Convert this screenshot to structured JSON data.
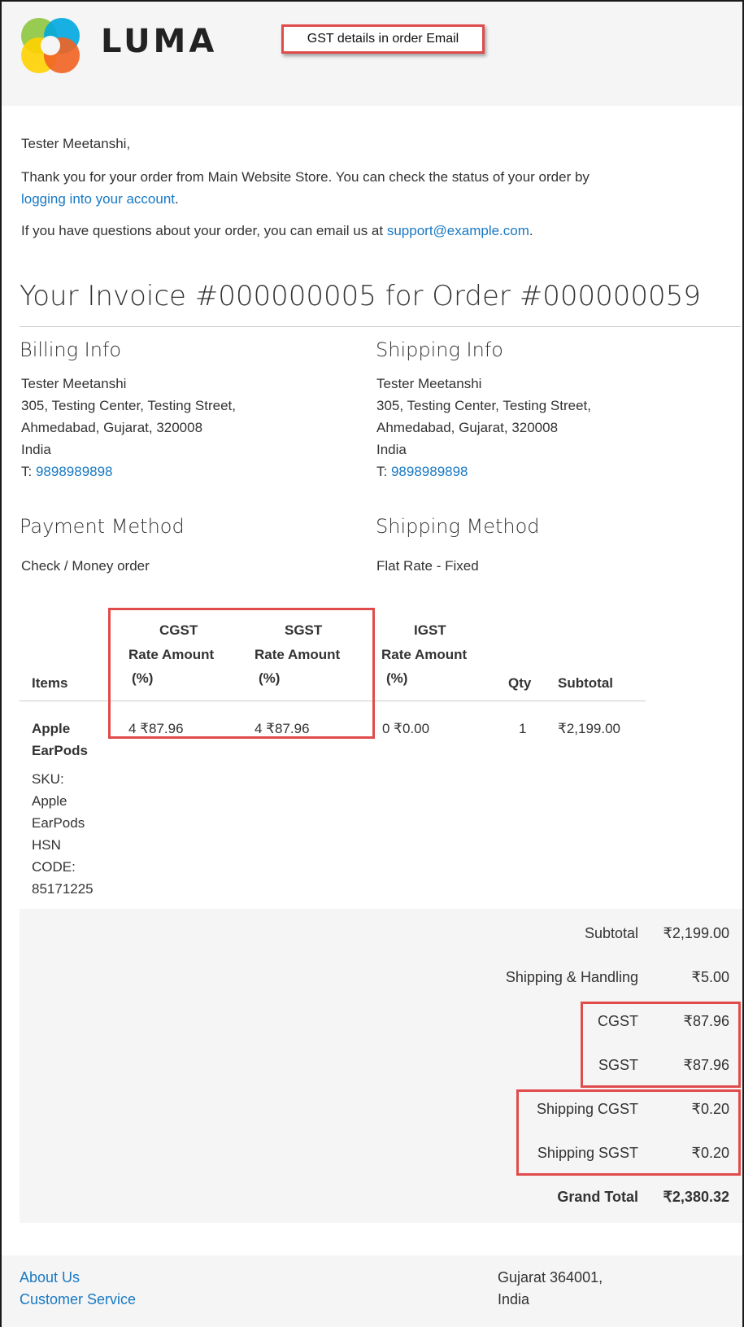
{
  "brand": {
    "logo_text": "LUMA",
    "colors": {
      "blue": "#1979c3",
      "red": "#e04b4b",
      "orange": "#f26322",
      "yellow": "#ffd200",
      "green": "#8dc63f",
      "teal": "#00a9e0"
    }
  },
  "annotation": {
    "label": "GST details in order Email"
  },
  "greeting": "Tester Meetanshi,",
  "intro": {
    "line1": "Thank you for your order from Main Website Store. You can check the status of your order by",
    "link": "logging into your account",
    "link_suffix": "."
  },
  "questions": {
    "text": "If you have questions about your order, you can email us at",
    "email": "support@example.com",
    "suffix": "."
  },
  "invoice_title": "Your Invoice #000000005 for Order #000000059",
  "billing": {
    "heading": "Billing Info",
    "name": "Tester Meetanshi",
    "street": "305, Testing Center, Testing Street,",
    "city": "Ahmedabad, Gujarat, 320008",
    "country": "India",
    "phone_label": "T:",
    "phone": "9898989898"
  },
  "shipping": {
    "heading": "Shipping Info",
    "name": "Tester Meetanshi",
    "street": "305, Testing Center, Testing Street,",
    "city": "Ahmedabad, Gujarat, 320008",
    "country": "India",
    "phone_label": "T:",
    "phone": "9898989898"
  },
  "payment": {
    "heading": "Payment Method",
    "value": "Check / Money order"
  },
  "shipping_method": {
    "heading": "Shipping Method",
    "value": "Flat Rate - Fixed"
  },
  "table": {
    "headers": {
      "items": "Items",
      "cgst": "CGST",
      "sgst": "SGST",
      "igst": "IGST",
      "rate_amount": "Rate Amount",
      "pct": "(%)",
      "qty": "Qty",
      "subtotal": "Subtotal"
    },
    "row": {
      "name_line1": "Apple",
      "name_line2": "EarPods",
      "sku_lines": [
        "SKU:",
        "Apple",
        "EarPods",
        "HSN",
        "CODE:",
        "85171225"
      ],
      "cgst": "4 ₹87.96",
      "sgst": "4 ₹87.96",
      "igst": "0 ₹0.00",
      "qty": "1",
      "subtotal": "₹2,199.00"
    }
  },
  "totals": {
    "subtotal_label": "Subtotal",
    "subtotal_value": "₹2,199.00",
    "shipping_label": "Shipping & Handling",
    "shipping_value": "₹5.00",
    "cgst_label": "CGST",
    "cgst_value": "₹87.96",
    "sgst_label": "SGST",
    "sgst_value": "₹87.96",
    "ship_cgst_label": "Shipping CGST",
    "ship_cgst_value": "₹0.20",
    "ship_sgst_label": "Shipping SGST",
    "ship_sgst_value": "₹0.20",
    "grand_label": "Grand Total",
    "grand_value": "₹2,380.32"
  },
  "footer": {
    "links": [
      "About Us",
      "Customer Service"
    ],
    "address_line1": "Gujarat 364001,",
    "address_line2": "India"
  }
}
